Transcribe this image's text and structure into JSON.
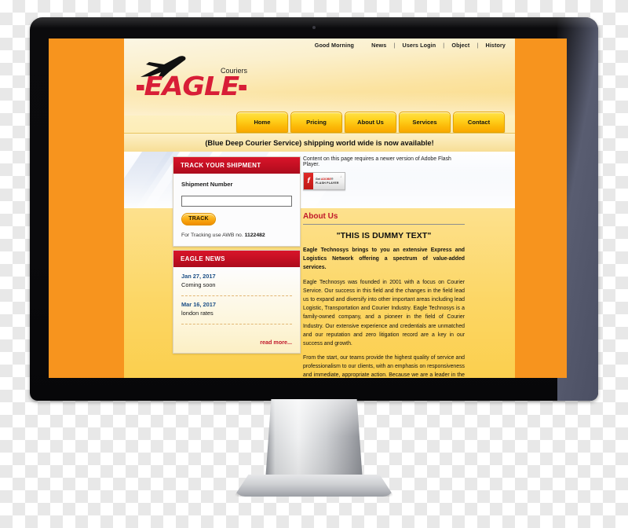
{
  "site": {
    "utility_nav": {
      "greeting": "Good Morning",
      "links": [
        "News",
        "Users Login",
        "Object",
        "History"
      ],
      "separator": "|"
    },
    "logo": {
      "wordmark": "EAGLE",
      "tagline": "Couriers",
      "plane_icon": "airplane-icon"
    },
    "main_nav": [
      "Home",
      "Pricing",
      "About Us",
      "Services",
      "Contact"
    ],
    "announcement": "(Blue Deep Courier Service) shipping world wide is now available!"
  },
  "track_panel": {
    "heading": "TRACK YOUR SHIPMENT",
    "field_label": "Shipment Number",
    "field_value": "",
    "field_placeholder": "",
    "button_label": "TRACK",
    "hint_prefix": "For Tracking use AWB no.",
    "hint_number": "1122482"
  },
  "news_panel": {
    "heading": "EAGLE NEWS",
    "items": [
      {
        "date": "Jan 27, 2017",
        "title": "Coming soon"
      },
      {
        "date": "Mar 16, 2017",
        "title": "london rates"
      }
    ],
    "read_more": "read more..."
  },
  "main": {
    "flash_notice": "Content on this page requires a newer version of Adobe Flash Player.",
    "flash_badge": {
      "icon": "adobe-flash-icon",
      "line1_prefix": "Get ",
      "line1_brand": "ADOBE",
      "line1_suffix": "®",
      "line2": "FLASH PLAYER",
      "corner_mark": "↓"
    },
    "section_title": "About Us",
    "dummy_heading": "\"THIS IS DUMMY TEXT\"",
    "paragraphs": [
      "Eagle Technosys brings to you an extensive Express and Logistics Network offering a spectrum of value-added services.",
      "Eagle Technosys was founded in 2001 with a focus on Courier Service. Our success in this field and the changes in the field lead us to expand and diversify into other important areas including lead Logistic, Transportation and Courier Industry. Eagle Technosys is a family-owned company, and a pioneer in the field of Courier Industry. Our extensive experience and credentials are unmatched and our reputation and zero litigation record are a key in our success and growth.",
      "From the start, our teams provide the highest quality of service and professionalism to our clients, with an emphasis on responsiveness and immediate, appropriate action. Because we are a leader in the industry, we remain up to date with the newest guidelines, procedures, equipment and regulations that affect fully satisfaction of Clients. The entire staff at Eagle Technosys is extensively trained and certified to handle all your valuable shipment as needs."
    ]
  },
  "colors": {
    "brand_red": "#C0182A",
    "brand_orange": "#F7941E",
    "nav_yellow": "#FFD21E",
    "news_date_blue": "#1C4F86",
    "bezel_dark": "#0B0B0D",
    "bezel_side": "#595D71"
  }
}
